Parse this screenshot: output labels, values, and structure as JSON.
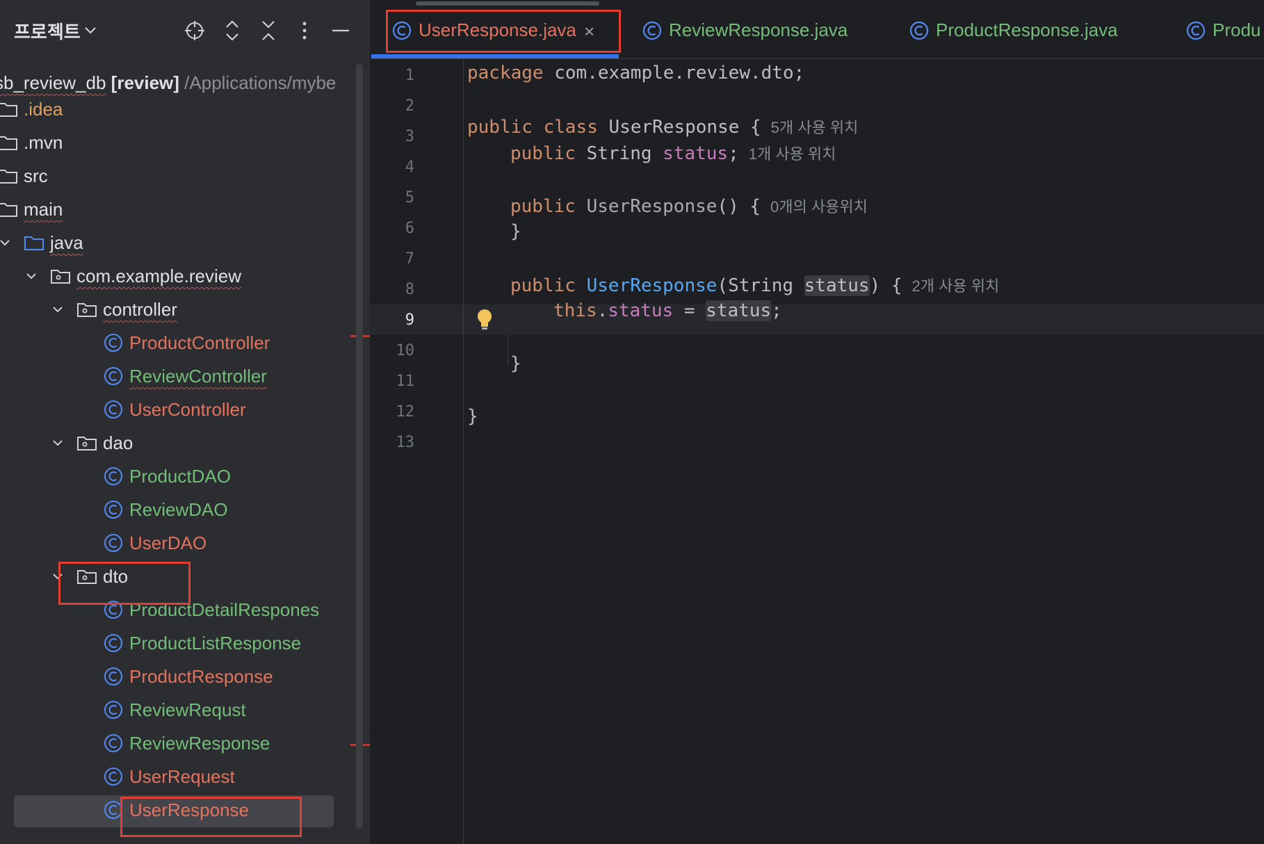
{
  "project_panel": {
    "title": "프로젝트",
    "header_buttons": [
      "locate-icon",
      "expand-all-icon",
      "collapse-all-icon",
      "more-icon",
      "hide-icon"
    ],
    "root": {
      "name": "sb_review_db",
      "module": "[review]",
      "path": "/Applications/mybe"
    },
    "items": [
      {
        "label": ".idea",
        "type": "folder",
        "color": "#e0a060"
      },
      {
        "label": ".mvn",
        "type": "folder",
        "color": "#dfe1e5"
      },
      {
        "label": "src",
        "type": "folder",
        "color": "#dfe1e5"
      },
      {
        "label": "main",
        "type": "folder",
        "color": "#dfe1e5"
      },
      {
        "label": "java",
        "type": "source-folder",
        "color": "#dfe1e5"
      },
      {
        "label": "com.example.review",
        "type": "package",
        "color": "#dfe1e5"
      },
      {
        "label": "controller",
        "type": "package",
        "color": "#dfe1e5"
      },
      {
        "label": "ProductController",
        "type": "class",
        "color": "#e5725f"
      },
      {
        "label": "ReviewController",
        "type": "class",
        "color": "#73bd79"
      },
      {
        "label": "UserController",
        "type": "class",
        "color": "#e5725f"
      },
      {
        "label": "dao",
        "type": "package",
        "color": "#dfe1e5"
      },
      {
        "label": "ProductDAO",
        "type": "class",
        "color": "#73bd79"
      },
      {
        "label": "ReviewDAO",
        "type": "class",
        "color": "#73bd79"
      },
      {
        "label": "UserDAO",
        "type": "class",
        "color": "#e5725f"
      },
      {
        "label": "dto",
        "type": "package",
        "color": "#dfe1e5"
      },
      {
        "label": "ProductDetailRespones",
        "type": "class",
        "color": "#73bd79"
      },
      {
        "label": "ProductListResponse",
        "type": "class",
        "color": "#73bd79"
      },
      {
        "label": "ProductResponse",
        "type": "class",
        "color": "#e5725f"
      },
      {
        "label": "ReviewRequst",
        "type": "class",
        "color": "#73bd79"
      },
      {
        "label": "ReviewResponse",
        "type": "class",
        "color": "#73bd79"
      },
      {
        "label": "UserRequest",
        "type": "class",
        "color": "#e5725f"
      },
      {
        "label": "UserResponse",
        "type": "class",
        "color": "#e5725f",
        "selected": true
      }
    ]
  },
  "editor": {
    "tabs": [
      {
        "label": "UserResponse.java",
        "active": true,
        "color": "#e5725f",
        "close": "×"
      },
      {
        "label": "ReviewResponse.java",
        "active": false,
        "color": "#73bd79"
      },
      {
        "label": "ProductResponse.java",
        "active": false,
        "color": "#73bd79"
      },
      {
        "label": "Produ",
        "active": false,
        "color": "#73bd79"
      }
    ],
    "current_line": 9,
    "line_numbers": [
      "1",
      "2",
      "3",
      "4",
      "5",
      "6",
      "7",
      "8",
      "9",
      "10",
      "11",
      "12",
      "13"
    ],
    "code": {
      "l1_kw": "package",
      "l1_rest": " com.example.review.dto;",
      "l3_kw1": "public",
      "l3_kw2": "class",
      "l3_name": " UserResponse {",
      "l3_hint": "5개 사용 위치",
      "l4_kw": "public",
      "l4_type": " String ",
      "l4_field": "status",
      "l4_end": ";",
      "l4_hint": "1개 사용 위치",
      "l6_kw": "public",
      "l6_fn": "UserResponse",
      "l6_end": "() {",
      "l6_hint": "0개의 사용위치",
      "l7": "}",
      "l9_kw": "public",
      "l9_fn": "UserResponse",
      "l9_mid": "(String ",
      "l9_param": "status",
      "l9_end": ") {",
      "l9_hint": "2개 사용 위치",
      "l10_kw": "this",
      "l10_dot": ".",
      "l10_field": "status",
      "l10_eq": " = ",
      "l10_param": "status",
      "l10_end": ";",
      "l11": "}",
      "l12": "}"
    }
  }
}
